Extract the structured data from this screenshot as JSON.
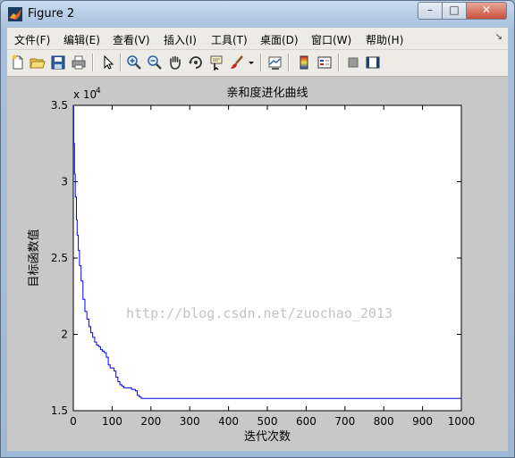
{
  "window": {
    "title": "Figure 2",
    "minimize_glyph": "–",
    "maximize_glyph": "□",
    "close_glyph": "✕"
  },
  "menu": {
    "items": [
      "文件(F)",
      "编辑(E)",
      "查看(V)",
      "插入(I)",
      "工具(T)",
      "桌面(D)",
      "窗口(W)",
      "帮助(H)"
    ],
    "overflow": "↘"
  },
  "toolbar": {
    "icons": [
      "new-figure-icon",
      "open-file-icon",
      "save-icon",
      "print-icon",
      "pointer-icon",
      "zoom-in-icon",
      "zoom-out-icon",
      "pan-hand-icon",
      "rotate-3d-icon",
      "data-cursor-icon",
      "brush-icon",
      "brush-dropdown-icon",
      "link-plot-icon",
      "colorbar-icon",
      "legend-icon",
      "hide-plot-tools-icon",
      "show-plot-tools-icon"
    ]
  },
  "watermark": "http://blog.csdn.net/zuochao_2013",
  "colors": {
    "line": "#0000ff",
    "plot_bg": "#ffffff",
    "figure_bg": "#c8c8c8"
  },
  "chart_data": {
    "type": "line",
    "title": "亲和度进化曲线",
    "xlabel": "迭代次数",
    "ylabel": "目标函数值",
    "y_exponent_label": "x 10",
    "y_exponent_power": "4",
    "xlim": [
      0,
      1000
    ],
    "ylim": [
      15000,
      35000
    ],
    "xticks": [
      0,
      100,
      200,
      300,
      400,
      500,
      600,
      700,
      800,
      900,
      1000
    ],
    "yticks": [
      15000,
      20000,
      25000,
      30000,
      35000
    ],
    "ytick_labels": [
      "1.5",
      "2",
      "2.5",
      "3",
      "3.5"
    ],
    "xtick_labels": [
      "0",
      "100",
      "200",
      "300",
      "400",
      "500",
      "600",
      "700",
      "800",
      "900",
      "1000"
    ],
    "grid": false,
    "series": [
      {
        "x": [
          0,
          1,
          3,
          5,
          8,
          10,
          13,
          16,
          20,
          25,
          30,
          35,
          40,
          45,
          50,
          55,
          60,
          65,
          70,
          75,
          80,
          85,
          90,
          95,
          100,
          105,
          110,
          115,
          120,
          125,
          130,
          135,
          140,
          150,
          160,
          165,
          170,
          175,
          180,
          200,
          300,
          400,
          500,
          600,
          700,
          800,
          900,
          1000
        ],
        "y": [
          35000,
          32500,
          30500,
          29000,
          27500,
          26500,
          25500,
          24500,
          23500,
          22300,
          21500,
          21000,
          20500,
          20100,
          19800,
          19500,
          19300,
          19200,
          19000,
          18900,
          18800,
          18500,
          18000,
          17800,
          17800,
          17600,
          17200,
          16900,
          16700,
          16600,
          16500,
          16500,
          16500,
          16400,
          16300,
          16000,
          15900,
          15800,
          15800,
          15800,
          15800,
          15800,
          15800,
          15800,
          15800,
          15800,
          15800,
          15800
        ]
      }
    ]
  }
}
